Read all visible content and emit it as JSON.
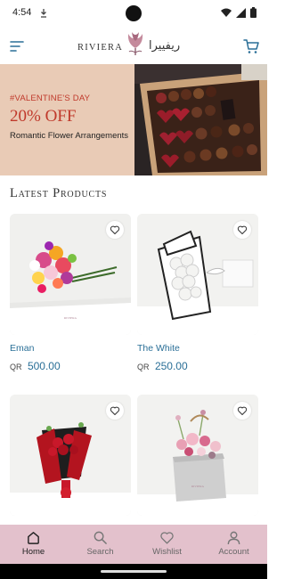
{
  "status": {
    "time": "4:54",
    "icons": [
      "notification-icon",
      "wifi-icon",
      "signal-icon",
      "battery-icon"
    ]
  },
  "header": {
    "logo_text": "RIVIERA",
    "logo_arabic": "ريفييرا",
    "menu_icon": "menu-icon",
    "cart_icon": "cart-icon"
  },
  "banner": {
    "tag": "#VALENTINE'S DAY",
    "discount": "20% OFF",
    "subtitle": "Romantic Flower Arrangements",
    "accent_color": "#c0392b",
    "background_color": "#e9cbb6"
  },
  "section": {
    "title": "Latest Products"
  },
  "products": [
    {
      "name": "Eman",
      "currency": "QR",
      "price": "500.00"
    },
    {
      "name": "The White",
      "currency": "QR",
      "price": "250.00"
    },
    {
      "name": "",
      "currency": "",
      "price": ""
    },
    {
      "name": "",
      "currency": "",
      "price": ""
    }
  ],
  "nav": {
    "items": [
      {
        "label": "Home",
        "icon": "home-icon",
        "active": true
      },
      {
        "label": "Search",
        "icon": "search-icon",
        "active": false
      },
      {
        "label": "Wishlist",
        "icon": "heart-icon",
        "active": false
      },
      {
        "label": "Account",
        "icon": "user-icon",
        "active": false
      }
    ],
    "background_color": "#e3c1cc"
  },
  "colors": {
    "link_blue": "#2a6f97"
  }
}
